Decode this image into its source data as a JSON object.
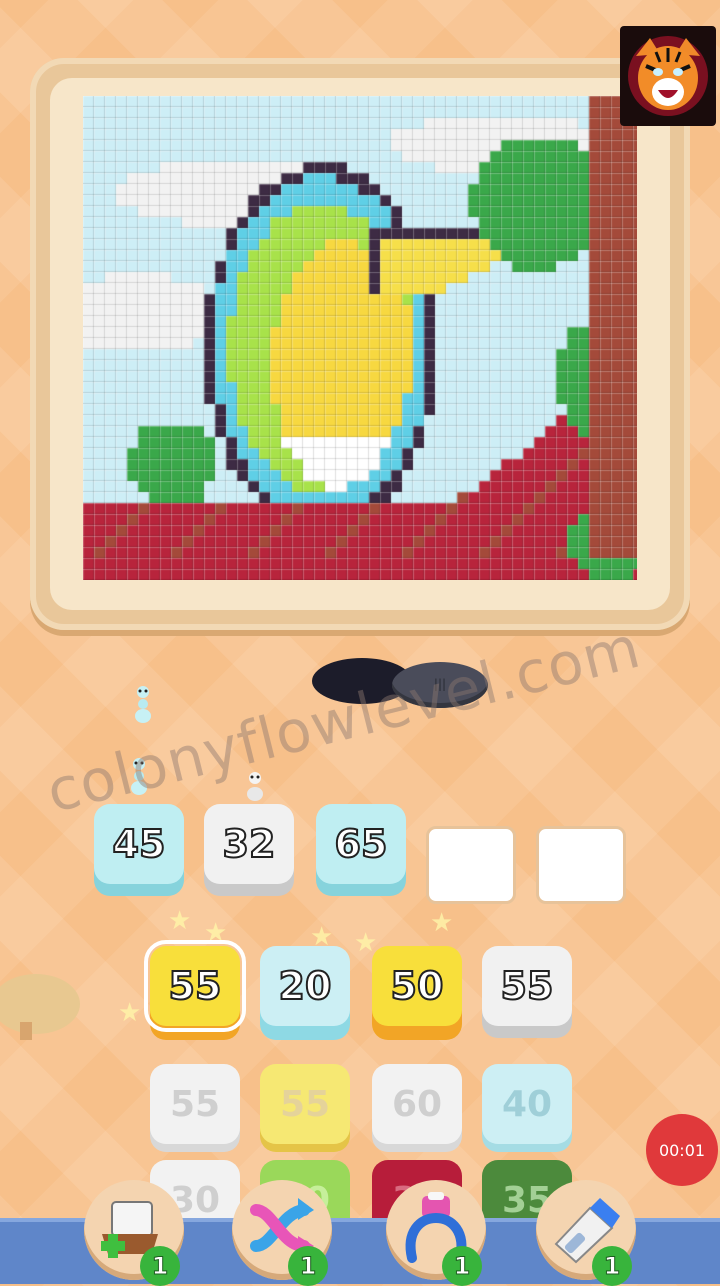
{
  "game": {
    "queue_tiles": [
      {
        "value": "45",
        "color": "blue"
      },
      {
        "value": "32",
        "color": "white"
      },
      {
        "value": "65",
        "color": "blue"
      },
      {
        "value": "",
        "color": "empty"
      },
      {
        "value": "",
        "color": "empty"
      }
    ],
    "active_row": [
      {
        "value": "55",
        "color": "yellow"
      },
      {
        "value": "20",
        "color": "iceblue"
      },
      {
        "value": "50",
        "color": "yellow"
      },
      {
        "value": "55",
        "color": "white"
      }
    ],
    "next_row": [
      {
        "value": "55",
        "color": "f-white"
      },
      {
        "value": "55",
        "color": "f-yellow"
      },
      {
        "value": "60",
        "color": "f-white"
      },
      {
        "value": "40",
        "color": "f-blue"
      }
    ],
    "last_row": [
      {
        "value": "30",
        "color": "f-white"
      },
      {
        "value": "30",
        "color": "f-green"
      },
      {
        "value": "35",
        "color": "f-red"
      },
      {
        "value": "35",
        "color": "f-dgreen"
      }
    ]
  },
  "watermark": "colonyflowlevel.com",
  "timer": "00:01",
  "powerups": [
    {
      "name": "add-tray",
      "count": "1"
    },
    {
      "name": "shuffle",
      "count": "1"
    },
    {
      "name": "magnet-claw",
      "count": "1"
    },
    {
      "name": "vacuum",
      "count": "1"
    }
  ],
  "colors": {
    "sky": "#cdeef6",
    "cloud": "#f2f2f2",
    "outline": "#3d2b44",
    "body_cyan": "#5fcfe6",
    "body_green": "#a8e24a",
    "belly_yellow": "#f7d840",
    "beak": "#f6df4a",
    "leaf": "#3aa84a",
    "branch": "#b8243c",
    "trunk": "#a44a3a"
  }
}
